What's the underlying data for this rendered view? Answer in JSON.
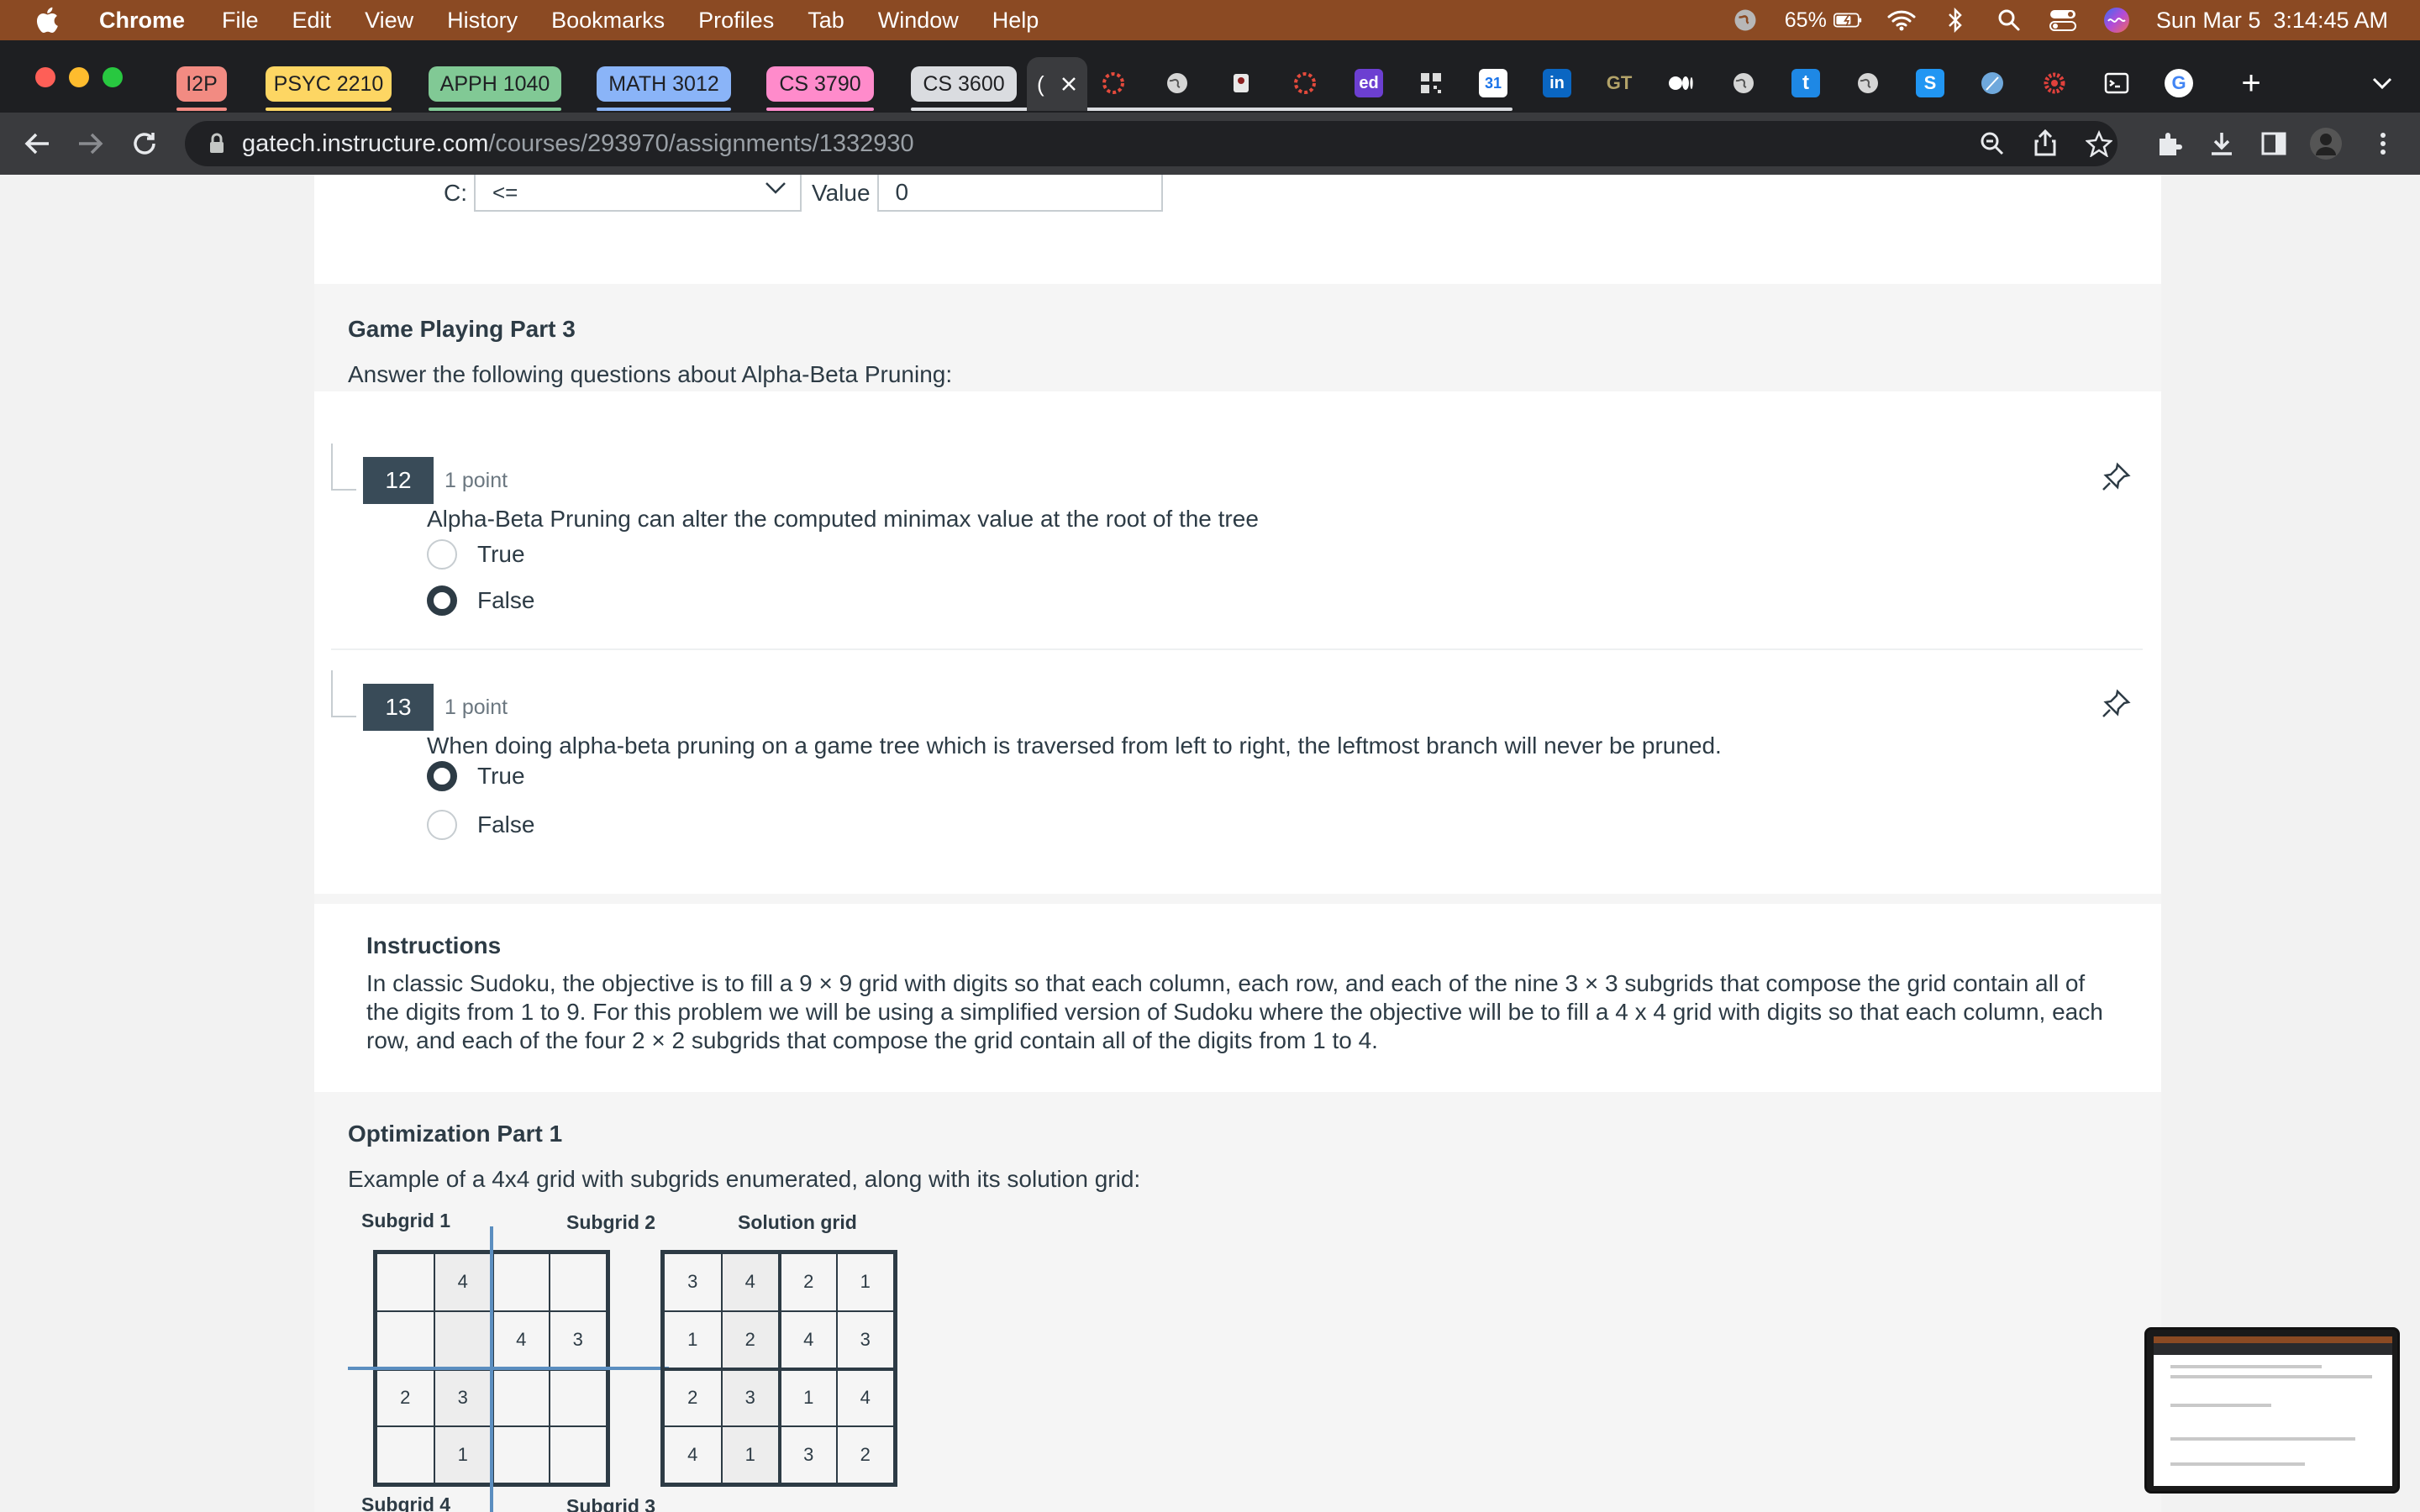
{
  "menubar": {
    "app_name": "Chrome",
    "items": [
      "File",
      "Edit",
      "View",
      "History",
      "Bookmarks",
      "Profiles",
      "Tab",
      "Window",
      "Help"
    ],
    "battery": "65%",
    "datetime": "Sun Mar 5  3:14:45 AM"
  },
  "tabs": {
    "groups": [
      {
        "label": "I2P",
        "color": "#f28b82"
      },
      {
        "label": "PSYC 2210",
        "color": "#fdd663"
      },
      {
        "label": "APPH 1040",
        "color": "#81c995"
      },
      {
        "label": "MATH 3012",
        "color": "#8ab4f8"
      },
      {
        "label": "CS 3790",
        "color": "#ff8bcb"
      },
      {
        "label": "CS 3600",
        "color": "#dadce0"
      }
    ],
    "active_tab_partial": "(",
    "new_tab_symbol": "+"
  },
  "address_bar": {
    "host": "gatech.instructure.com",
    "path": "/courses/293970/assignments/1332930"
  },
  "prev_question": {
    "c_label": "C:",
    "c_value": "<=",
    "value_label": "Value",
    "value": "0"
  },
  "game_part3": {
    "title": "Game Playing Part 3",
    "text": "Answer the following questions about Alpha-Beta Pruning:"
  },
  "questions": [
    {
      "number": "12",
      "points": "1 point",
      "text": "Alpha-Beta Pruning can alter the computed minimax value at the root of the tree",
      "answers": [
        {
          "label": "True",
          "checked": false
        },
        {
          "label": "False",
          "checked": true
        }
      ]
    },
    {
      "number": "13",
      "points": "1 point",
      "text": "When doing alpha-beta pruning on a game tree which is traversed from left to right, the leftmost branch will never be pruned.",
      "answers": [
        {
          "label": "True",
          "checked": true
        },
        {
          "label": "False",
          "checked": false
        }
      ]
    }
  ],
  "instructions": {
    "title": "Instructions",
    "body": "In classic Sudoku, the objective is to fill a 9 × 9 grid with digits so that each column, each row, and each of the nine 3 × 3 subgrids that compose the grid contain all of the digits from 1 to 9. For this problem we will be using a simplified version of Sudoku where the objective will be to fill a 4 x 4 grid with digits so that each column, each row, and each of the four 2 × 2 subgrids that compose the grid contain all of the digits from 1 to 4."
  },
  "optimization_part1": {
    "title": "Optimization Part 1",
    "text": "Example of a 4x4 grid with subgrids enumerated, along with its solution grid:",
    "labels": {
      "subgrid1": "Subgrid 1",
      "subgrid2": "Subgrid 2",
      "subgrid3": "Subgrid 3",
      "subgrid4": "Subgrid 4",
      "solution": "Solution grid"
    },
    "puzzle": [
      [
        "",
        "4",
        "",
        ""
      ],
      [
        "",
        "",
        "4",
        "3"
      ],
      [
        "2",
        "3",
        "",
        ""
      ],
      [
        "",
        "1",
        "",
        ""
      ]
    ],
    "solution": [
      [
        "3",
        "4",
        "2",
        "1"
      ],
      [
        "1",
        "2",
        "4",
        "3"
      ],
      [
        "2",
        "3",
        "1",
        "4"
      ],
      [
        "4",
        "1",
        "3",
        "2"
      ]
    ]
  }
}
